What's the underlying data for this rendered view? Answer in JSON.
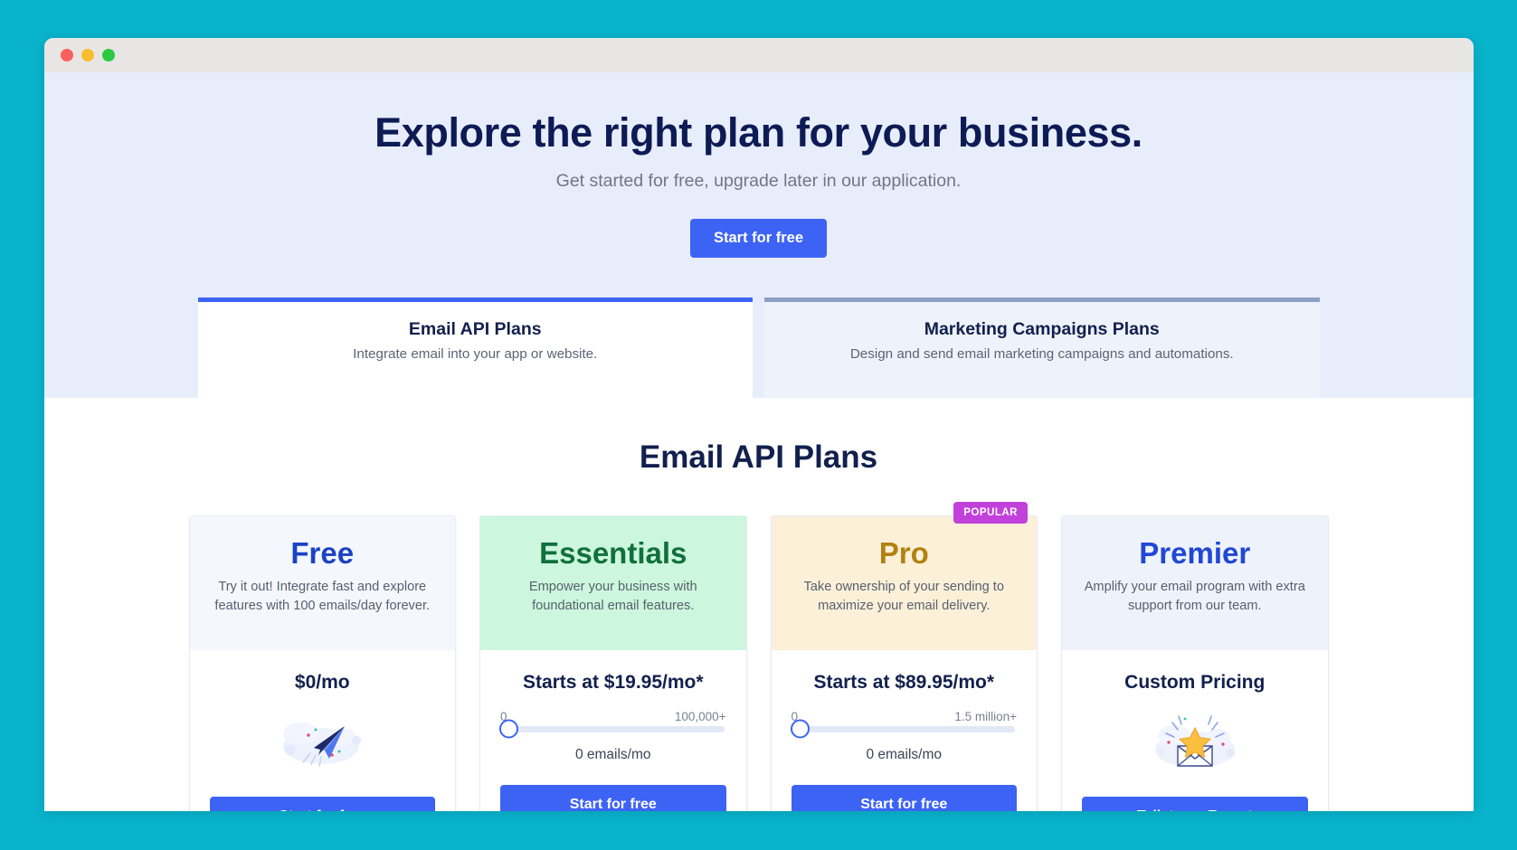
{
  "window": {
    "controls": [
      "close",
      "minimize",
      "maximize"
    ]
  },
  "hero": {
    "title": "Explore the right plan for your business.",
    "subtitle": "Get started for free, upgrade later in our application.",
    "cta_label": "Start for free"
  },
  "tabs": [
    {
      "label": "Email API Plans",
      "description": "Integrate email into your app or website.",
      "active": true
    },
    {
      "label": "Marketing Campaigns Plans",
      "description": "Design and send email marketing campaigns and automations.",
      "active": false
    }
  ],
  "plans_section": {
    "heading": "Email API Plans",
    "cards": [
      {
        "name": "Free",
        "tagline": "Try it out! Integrate fast and explore features with 100 emails/day forever.",
        "price": "$0/mo",
        "has_slider": false,
        "illustration": "paper-plane",
        "cta_label": "Start for free",
        "badge": null
      },
      {
        "name": "Essentials",
        "tagline": "Empower your business with foundational email features.",
        "price": "Starts at $19.95/mo*",
        "has_slider": true,
        "slider_min_label": "0",
        "slider_max_label": "100,000+",
        "slider_value_label": "0 emails/mo",
        "slider_percent": 0,
        "illustration": null,
        "cta_label": "Start for free",
        "badge": null
      },
      {
        "name": "Pro",
        "tagline": "Take ownership of your sending to maximize your email delivery.",
        "price": "Starts at $89.95/mo*",
        "has_slider": true,
        "slider_min_label": "0",
        "slider_max_label": "1.5 million+",
        "slider_value_label": "0 emails/mo",
        "slider_percent": 0,
        "illustration": null,
        "cta_label": "Start for free",
        "badge": "POPULAR"
      },
      {
        "name": "Premier",
        "tagline": "Amplify your email program with extra support from our team.",
        "price": "Custom Pricing",
        "has_slider": false,
        "illustration": "envelope-star",
        "cta_label": "Talk to an Expert",
        "badge": null
      }
    ]
  },
  "colors": {
    "desktop_background": "#09b3cc",
    "hero_background": "#e7edfb",
    "primary_button": "#3d63f5",
    "heading_navy": "#12204d",
    "badge_purple": "#c141da",
    "free_header": "#f4f7fe",
    "essentials_header": "#ccf7de",
    "pro_header": "#fcf0d9",
    "premier_header": "#eef2fb",
    "free_title": "#1b43c4",
    "essentials_title": "#11703b",
    "pro_title": "#b08311",
    "premier_title": "#2048d6"
  }
}
